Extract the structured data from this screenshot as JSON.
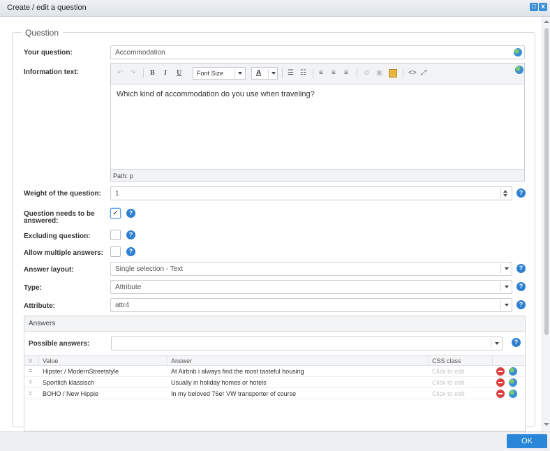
{
  "window": {
    "title": "Create / edit a question",
    "min_icon": "□",
    "close_icon": "x"
  },
  "legend": "Question",
  "fields": {
    "your_question": {
      "label": "Your question:",
      "value": "Accommodation"
    },
    "information_text": {
      "label": "Information text:",
      "toolbar": {
        "undo": "↶",
        "redo": "↷",
        "bold": "B",
        "italic": "I",
        "underline": "U",
        "font_size": "Font Size",
        "font_color": "A",
        "ul": "☰",
        "ol": "☷",
        "align_left": "≡",
        "align_center": "≡",
        "align_right": "≡",
        "code": "<>",
        "fullscreen": "⤢"
      },
      "body": "Which kind of accommodation do you use when traveling?",
      "path": "Path: p"
    },
    "weight": {
      "label": "Weight of the question:",
      "value": "1"
    },
    "needs_answer": {
      "label_line1": "Question needs to be",
      "label_line2": "answered:",
      "checked": true,
      "check_glyph": "✓"
    },
    "excluding": {
      "label": "Excluding question:",
      "checked": false
    },
    "multiple": {
      "label": "Allow multiple answers:",
      "checked": false
    },
    "answer_layout": {
      "label": "Answer layout:",
      "value": "Single selection - Text"
    },
    "type": {
      "label": "Type:",
      "value": "Attribute"
    },
    "attribute": {
      "label": "Attribute:",
      "value": "attr4"
    }
  },
  "answers": {
    "header": "Answers",
    "possible_label": "Possible answers:",
    "possible_value": "",
    "columns": [
      "Value",
      "Answer",
      "CSS class"
    ],
    "drag_glyph": "=",
    "rows": [
      {
        "value": "Hipster / ModernStreetstyle",
        "answer": "At Airbnb i always find the most tasteful housing",
        "css": "Click to edit"
      },
      {
        "value": "Sportlich klassisch",
        "answer": "Usually in holiday homes or hotels",
        "css": "Click to edit"
      },
      {
        "value": "BOHO / New Hippie",
        "answer": "In my beloved 76er VW transporter of course",
        "css": "Click to edit"
      }
    ]
  },
  "help_glyph": "?",
  "ok_label": "OK"
}
